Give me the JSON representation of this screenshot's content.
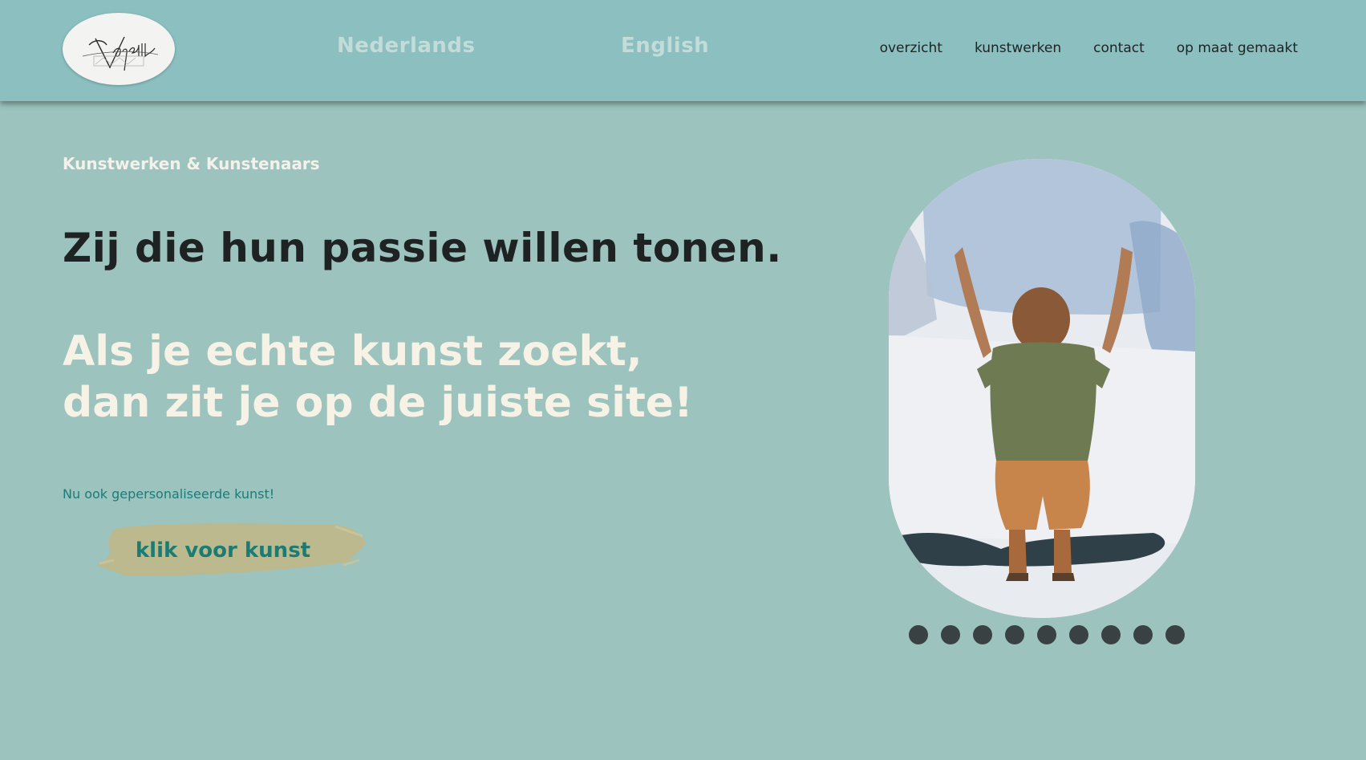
{
  "header": {
    "logo_text": "Vajelle",
    "languages": [
      "Nederlands",
      "English"
    ],
    "nav": [
      "overzicht",
      "kunstwerken",
      "contact",
      "op maat gemaakt"
    ]
  },
  "hero": {
    "subtitle": "Kunstwerken & Kunstenaars",
    "headline": "Zij die hun passie willen tonen.",
    "tagline_line1": "Als je echte kunst zoekt,",
    "tagline_line2": "dan zit je op de juiste site!",
    "promo": "Nu ook gepersonaliseerde kunst!",
    "cta_label": "klik voor kunst"
  },
  "slider": {
    "artwork": "watercolor-child-painting",
    "dot_count": 9
  },
  "colors": {
    "background": "#9cc3be",
    "header": "#8bbfc0",
    "cta_brush": "#bcb98e",
    "accent_teal": "#1b7c74",
    "dot": "#3a4142"
  }
}
